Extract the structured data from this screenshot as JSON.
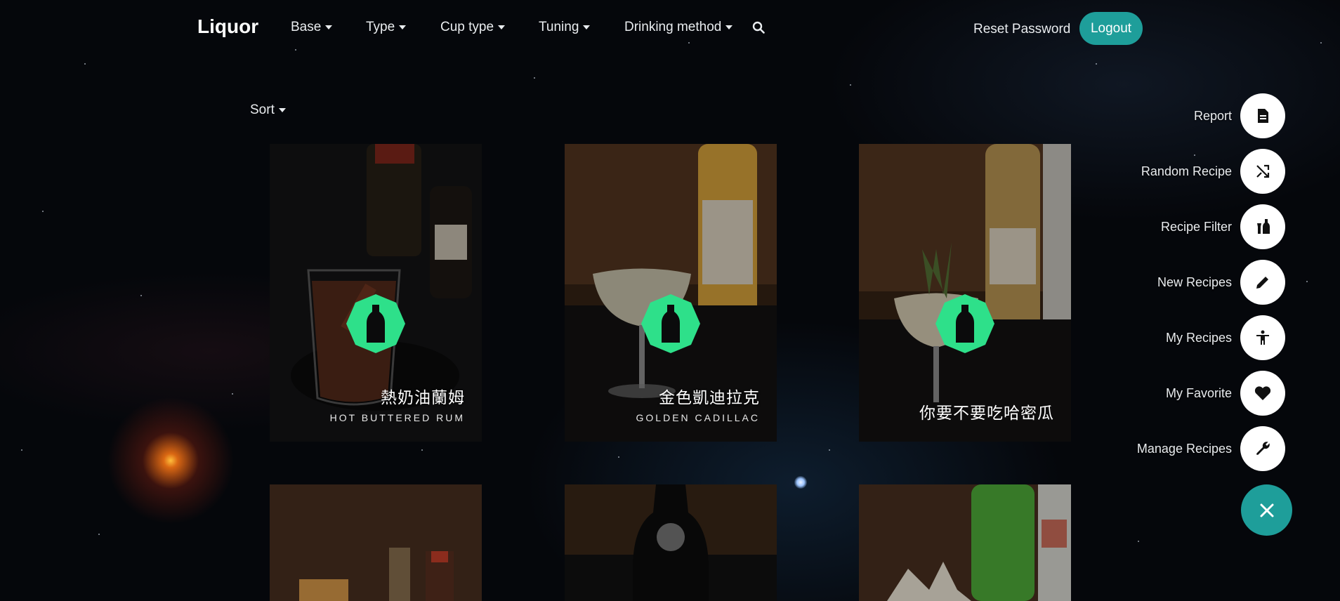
{
  "nav": {
    "brand": "Liquor",
    "items": [
      {
        "label": "Base"
      },
      {
        "label": "Type"
      },
      {
        "label": "Cup type"
      },
      {
        "label": "Tuning"
      },
      {
        "label": "Drinking method"
      }
    ],
    "search_icon": "search-icon",
    "reset_password": "Reset Password",
    "logout": "Logout",
    "accent_color": "#1e9e9a"
  },
  "sort": {
    "label": "Sort"
  },
  "cards": [
    {
      "name_zh": "熱奶油蘭姆",
      "name_en": "HOT BUTTERED RUM",
      "icon": "bottle-icon"
    },
    {
      "name_zh": "金色凱迪拉克",
      "name_en": "GOLDEN CADILLAC",
      "icon": "bottle-icon"
    },
    {
      "name_zh": "你要不要吃哈密瓜",
      "name_en": "",
      "icon": "bottle-icon"
    },
    {
      "name_zh": "",
      "name_en": ""
    },
    {
      "name_zh": "",
      "name_en": ""
    },
    {
      "name_zh": "",
      "name_en": ""
    }
  ],
  "badge_color": "#2ee08a",
  "fab_menu": [
    {
      "label": "Report",
      "icon": "report-icon"
    },
    {
      "label": "Random Recipe",
      "icon": "shuffle-icon"
    },
    {
      "label": "Recipe Filter",
      "icon": "bottles-icon"
    },
    {
      "label": "New Recipes",
      "icon": "pencil-icon"
    },
    {
      "label": "My Recipes",
      "icon": "person-icon"
    },
    {
      "label": "My Favorite",
      "icon": "heart-icon"
    },
    {
      "label": "Manage Recipes",
      "icon": "wrench-icon"
    }
  ],
  "fab_close_icon": "close-icon"
}
